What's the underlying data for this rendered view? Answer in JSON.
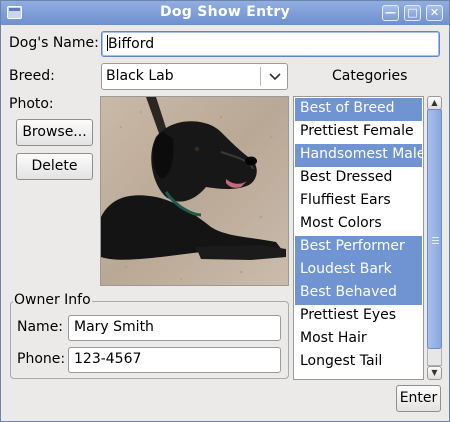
{
  "window": {
    "title": "Dog Show Entry",
    "controls": [
      "minimize",
      "maximize",
      "close"
    ]
  },
  "form": {
    "dog_name_label": "Dog's Name:",
    "dog_name_value": "Bifford",
    "breed_label": "Breed:",
    "breed_value": "Black Lab",
    "photo_label": "Photo:",
    "browse_label": "Browse...",
    "delete_label": "Delete"
  },
  "categories": {
    "label": "Categories",
    "items": [
      {
        "label": "Best of Breed",
        "selected": true
      },
      {
        "label": "Prettiest Female",
        "selected": false
      },
      {
        "label": "Handsomest Male",
        "selected": true
      },
      {
        "label": "Best Dressed",
        "selected": false
      },
      {
        "label": "Fluffiest Ears",
        "selected": false
      },
      {
        "label": "Most Colors",
        "selected": false
      },
      {
        "label": "Best Performer",
        "selected": true
      },
      {
        "label": "Loudest Bark",
        "selected": true
      },
      {
        "label": "Best Behaved",
        "selected": true
      },
      {
        "label": "Prettiest Eyes",
        "selected": false
      },
      {
        "label": "Most Hair",
        "selected": false
      },
      {
        "label": "Longest Tail",
        "selected": false
      }
    ]
  },
  "owner": {
    "group_title": "Owner Info",
    "name_label": "Name:",
    "name_value": "Mary Smith",
    "phone_label": "Phone:",
    "phone_value": "123-4567"
  },
  "actions": {
    "enter_label": "Enter"
  },
  "colors": {
    "titlebar": "#7f9ed8",
    "selection": "#6f94d1",
    "window_bg": "#eceae8"
  }
}
